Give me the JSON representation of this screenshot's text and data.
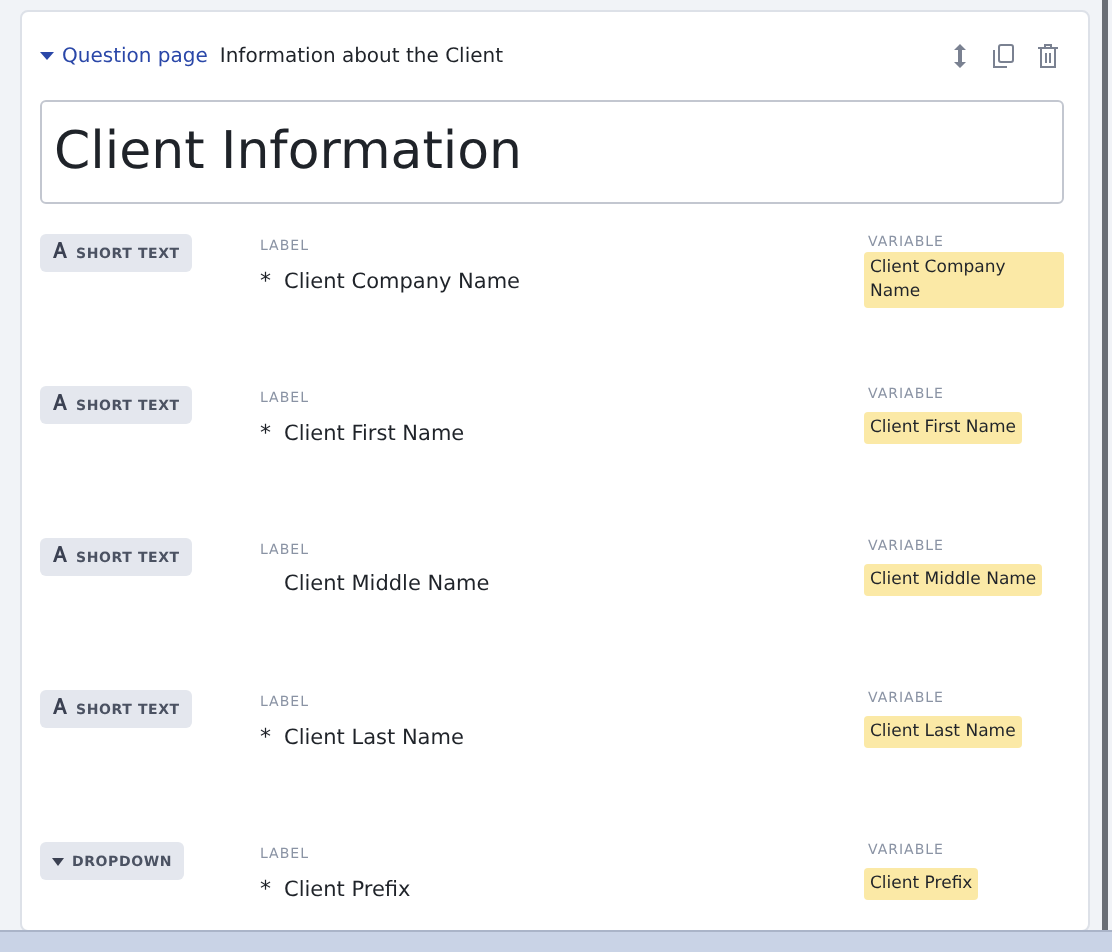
{
  "header": {
    "section_link": "Question page",
    "page_title": "Information about the Client"
  },
  "title_field": {
    "value": "Client Information"
  },
  "questions": [
    {
      "kind": "short_text",
      "type_label": "SHORT TEXT",
      "label_heading": "LABEL",
      "required": true,
      "required_mark": "*",
      "label": "Client Company Name",
      "variable_heading": "VARIABLE",
      "variable": "Client Company Name"
    },
    {
      "kind": "short_text",
      "type_label": "SHORT TEXT",
      "label_heading": "LABEL",
      "required": true,
      "required_mark": "*",
      "label": "Client First Name",
      "variable_heading": "VARIABLE",
      "variable": "Client First Name"
    },
    {
      "kind": "short_text",
      "type_label": "SHORT TEXT",
      "label_heading": "LABEL",
      "required": false,
      "label": "Client Middle Name",
      "variable_heading": "VARIABLE",
      "variable": "Client Middle Name"
    },
    {
      "kind": "short_text",
      "type_label": "SHORT TEXT",
      "label_heading": "LABEL",
      "required": true,
      "required_mark": "*",
      "label": "Client Last Name",
      "variable_heading": "VARIABLE",
      "variable": "Client Last Name"
    },
    {
      "kind": "dropdown",
      "type_label": "DROPDOWN",
      "label_heading": "LABEL",
      "required": true,
      "required_mark": "*",
      "label": "Client Prefix",
      "variable_heading": "VARIABLE",
      "variable": "Client Prefix"
    }
  ]
}
